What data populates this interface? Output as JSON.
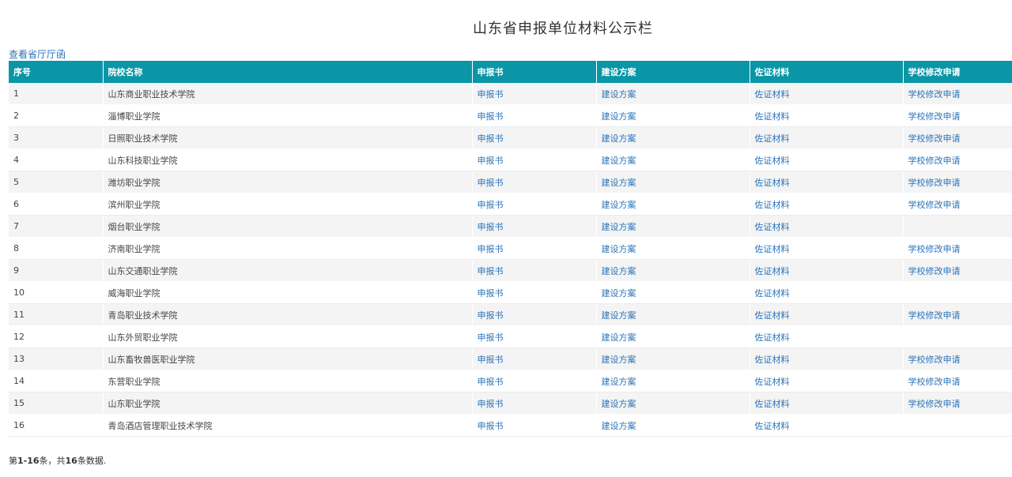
{
  "page": {
    "title": "山东省申报单位材料公示栏",
    "top_link": "查看省厅厅函"
  },
  "table": {
    "headers": [
      "序号",
      "院校名称",
      "申报书",
      "建设方案",
      "佐证材料",
      "学校修改申请"
    ],
    "rows": [
      {
        "idx": "1",
        "name": "山东商业职业技术学院",
        "a": "申报书",
        "b": "建设方案",
        "c": "佐证材料",
        "d": "学校修改申请"
      },
      {
        "idx": "2",
        "name": "淄博职业学院",
        "a": "申报书",
        "b": "建设方案",
        "c": "佐证材料",
        "d": "学校修改申请"
      },
      {
        "idx": "3",
        "name": "日照职业技术学院",
        "a": "申报书",
        "b": "建设方案",
        "c": "佐证材料",
        "d": "学校修改申请"
      },
      {
        "idx": "4",
        "name": "山东科技职业学院",
        "a": "申报书",
        "b": "建设方案",
        "c": "佐证材料",
        "d": "学校修改申请"
      },
      {
        "idx": "5",
        "name": "潍坊职业学院",
        "a": "申报书",
        "b": "建设方案",
        "c": "佐证材料",
        "d": "学校修改申请"
      },
      {
        "idx": "6",
        "name": "滨州职业学院",
        "a": "申报书",
        "b": "建设方案",
        "c": "佐证材料",
        "d": "学校修改申请"
      },
      {
        "idx": "7",
        "name": "烟台职业学院",
        "a": "申报书",
        "b": "建设方案",
        "c": "佐证材料",
        "d": ""
      },
      {
        "idx": "8",
        "name": "济南职业学院",
        "a": "申报书",
        "b": "建设方案",
        "c": "佐证材料",
        "d": "学校修改申请"
      },
      {
        "idx": "9",
        "name": "山东交通职业学院",
        "a": "申报书",
        "b": "建设方案",
        "c": "佐证材料",
        "d": "学校修改申请"
      },
      {
        "idx": "10",
        "name": "威海职业学院",
        "a": "申报书",
        "b": "建设方案",
        "c": "佐证材料",
        "d": ""
      },
      {
        "idx": "11",
        "name": "青岛职业技术学院",
        "a": "申报书",
        "b": "建设方案",
        "c": "佐证材料",
        "d": "学校修改申请"
      },
      {
        "idx": "12",
        "name": "山东外贸职业学院",
        "a": "申报书",
        "b": "建设方案",
        "c": "佐证材料",
        "d": ""
      },
      {
        "idx": "13",
        "name": "山东畜牧兽医职业学院",
        "a": "申报书",
        "b": "建设方案",
        "c": "佐证材料",
        "d": "学校修改申请"
      },
      {
        "idx": "14",
        "name": "东营职业学院",
        "a": "申报书",
        "b": "建设方案",
        "c": "佐证材料",
        "d": "学校修改申请"
      },
      {
        "idx": "15",
        "name": "山东职业学院",
        "a": "申报书",
        "b": "建设方案",
        "c": "佐证材料",
        "d": "学校修改申请"
      },
      {
        "idx": "16",
        "name": "青岛酒店管理职业技术学院",
        "a": "申报书",
        "b": "建设方案",
        "c": "佐证材料",
        "d": ""
      }
    ]
  },
  "summary": {
    "prefix": "第",
    "range": "1-16",
    "middle": "条，共",
    "total": "16",
    "suffix": "条数据."
  },
  "colors": {
    "header_bg": "#0a96a6",
    "link": "#2a73b8"
  }
}
